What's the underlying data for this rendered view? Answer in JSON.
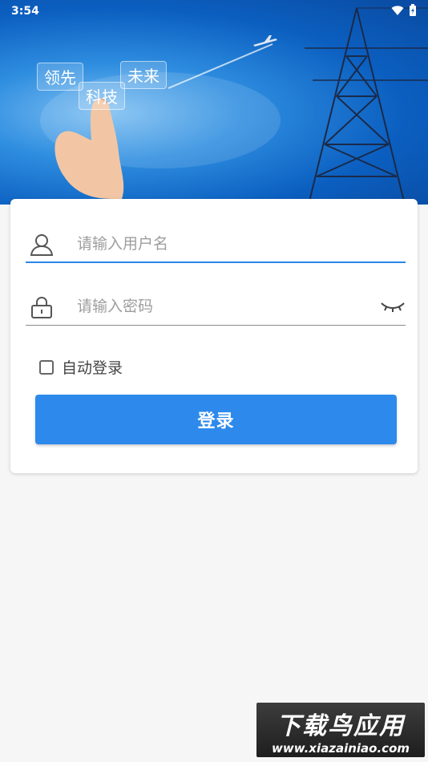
{
  "status_bar": {
    "time": "3:54"
  },
  "banner": {
    "bubbles": [
      "领先",
      "科技",
      "未来"
    ]
  },
  "login": {
    "username_placeholder": "请输入用户名",
    "password_placeholder": "请输入密码",
    "auto_login_label": "自动登录",
    "auto_login_checked": false,
    "login_button": "登录"
  },
  "watermark": {
    "title": "下载鸟应用",
    "url": "www.xiazainiao.com"
  },
  "colors": {
    "accent": "#2d8aec",
    "underline_active": "#2d86e6"
  }
}
